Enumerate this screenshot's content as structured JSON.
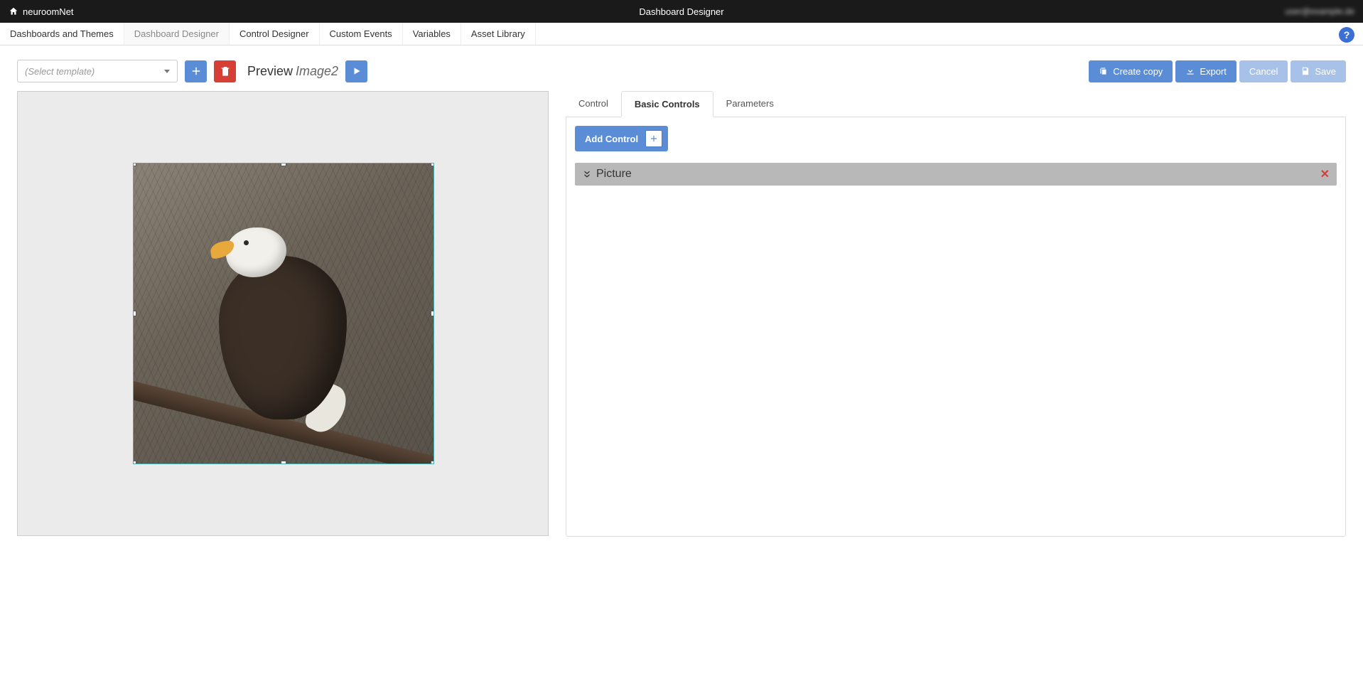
{
  "topbar": {
    "brand": "neuroomNet",
    "title": "Dashboard Designer",
    "user_blurred": "user@example.de"
  },
  "nav": {
    "tabs": [
      {
        "label": "Dashboards and Themes"
      },
      {
        "label": "Dashboard Designer",
        "active": true
      },
      {
        "label": "Control Designer"
      },
      {
        "label": "Custom Events"
      },
      {
        "label": "Variables"
      },
      {
        "label": "Asset Library"
      }
    ],
    "help_tooltip": "?"
  },
  "toolbar": {
    "template_placeholder": "(Select template)",
    "preview_label": "Preview",
    "preview_item": "Image2",
    "buttons": {
      "create_copy": "Create copy",
      "export": "Export",
      "cancel": "Cancel",
      "save": "Save"
    }
  },
  "inspector": {
    "tabs": [
      {
        "label": "Control"
      },
      {
        "label": "Basic Controls",
        "active": true
      },
      {
        "label": "Parameters"
      }
    ],
    "add_control": "Add Control",
    "rows": [
      {
        "label": "Picture"
      }
    ]
  }
}
